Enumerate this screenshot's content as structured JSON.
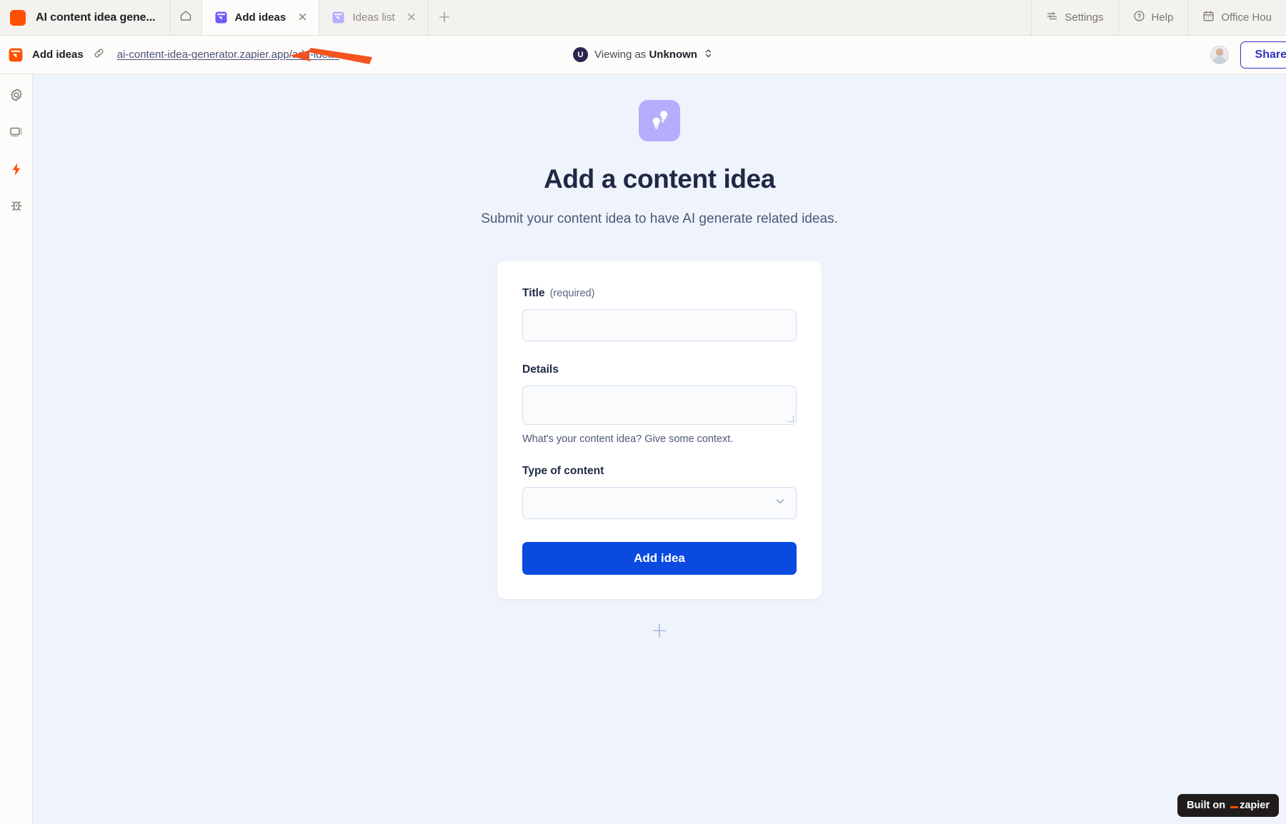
{
  "window": {
    "brand_title": "AI content idea gene...",
    "brand_color": "#ff4f00"
  },
  "tabbar": {
    "home_icon": "home-icon",
    "new_tab_label": "+",
    "tabs": [
      {
        "label": "Add ideas",
        "icon": "zapier-interface-icon",
        "active": true,
        "close": "×"
      },
      {
        "label": "Ideas list",
        "icon": "zapier-interface-icon",
        "active": false,
        "close": "×"
      }
    ],
    "right_items": [
      {
        "label": "Settings",
        "icon": "sliders-icon"
      },
      {
        "label": "Help",
        "icon": "question-circle-icon"
      },
      {
        "label": "Office Hou",
        "icon": "calendar-icon"
      }
    ]
  },
  "urlbar": {
    "app_name": "Add ideas",
    "link_icon": "link-icon",
    "url": "ai-content-idea-generator.zapier.app/add-ideas",
    "viewing_avatar_initial": "U",
    "viewing_prefix": "Viewing as ",
    "viewing_user": "Unknown",
    "viewing_chevron": "chevron-updown-icon",
    "share_label": "Share"
  },
  "rail": {
    "items": [
      {
        "name": "settings-gear-icon",
        "active": false
      },
      {
        "name": "layout-page-icon",
        "active": false
      },
      {
        "name": "zap-lightning-icon",
        "active": true,
        "color": "#ff4f00"
      },
      {
        "name": "bug-debug-icon",
        "active": false
      }
    ]
  },
  "main": {
    "logo_icon": "lightbulbs-icon",
    "logo_bg": "#b4aefc",
    "title": "Add a content idea",
    "subtitle": "Submit your content idea to have AI generate related ideas.",
    "form": {
      "title_field": {
        "label": "Title",
        "required_note": "(required)",
        "value": "",
        "placeholder": ""
      },
      "details_field": {
        "label": "Details",
        "value": "",
        "placeholder": "",
        "help": "What's your content idea? Give some context."
      },
      "type_field": {
        "label": "Type of content",
        "value": "",
        "chevron": "chevron-down-icon"
      },
      "submit_label": "Add idea"
    },
    "add_block_label": "+"
  },
  "footer": {
    "built_on": "Built on",
    "brand": "zapier",
    "brand_accent": "#ff4f00"
  },
  "annotation": {
    "arrow_color": "#f4521e",
    "points_at": "url-link"
  }
}
